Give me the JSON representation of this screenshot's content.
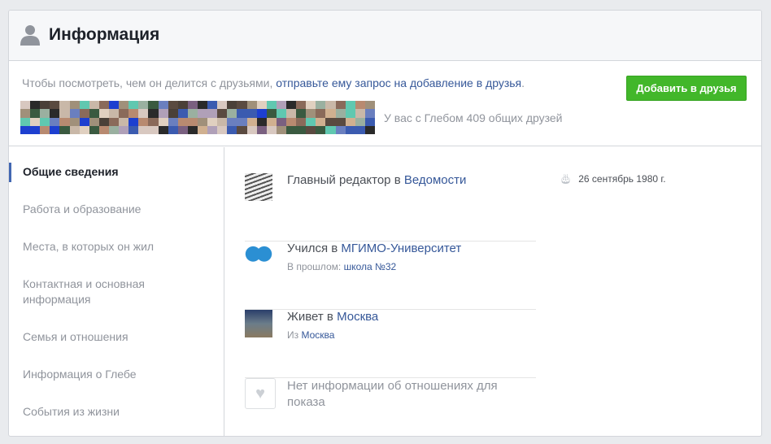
{
  "header": {
    "title": "Информация"
  },
  "notice": {
    "prefix": "Чтобы посмотреть, чем он делится с друзьями,",
    "link": "отправьте ему запрос на добавление в друзья",
    "suffix": "."
  },
  "add_friend_label": "Добавить в друзья",
  "mutual_friends": "У вас с Глебом 409 общих друзей",
  "nav": [
    "Общие сведения",
    "Работа и образование",
    "Места, в которых он жил",
    "Контактная и основная информация",
    "Семья и отношения",
    "Информация о Глебе",
    "События из жизни"
  ],
  "work": {
    "text": "Главный редактор в",
    "link": "Ведомости"
  },
  "education": {
    "text": "Учился в",
    "link": "МГИМО-Университет",
    "past_label": "В прошлом:",
    "past_link": "школа №32"
  },
  "residence": {
    "text": "Живет в",
    "link": "Москва",
    "from_label": "Из",
    "from_link": "Москва"
  },
  "relationship": {
    "text": "Нет информации об отношениях для показа"
  },
  "birthday": "26 сентябрь 1980 г.",
  "colors": {
    "accent": "#42b72a",
    "link": "#365899"
  }
}
